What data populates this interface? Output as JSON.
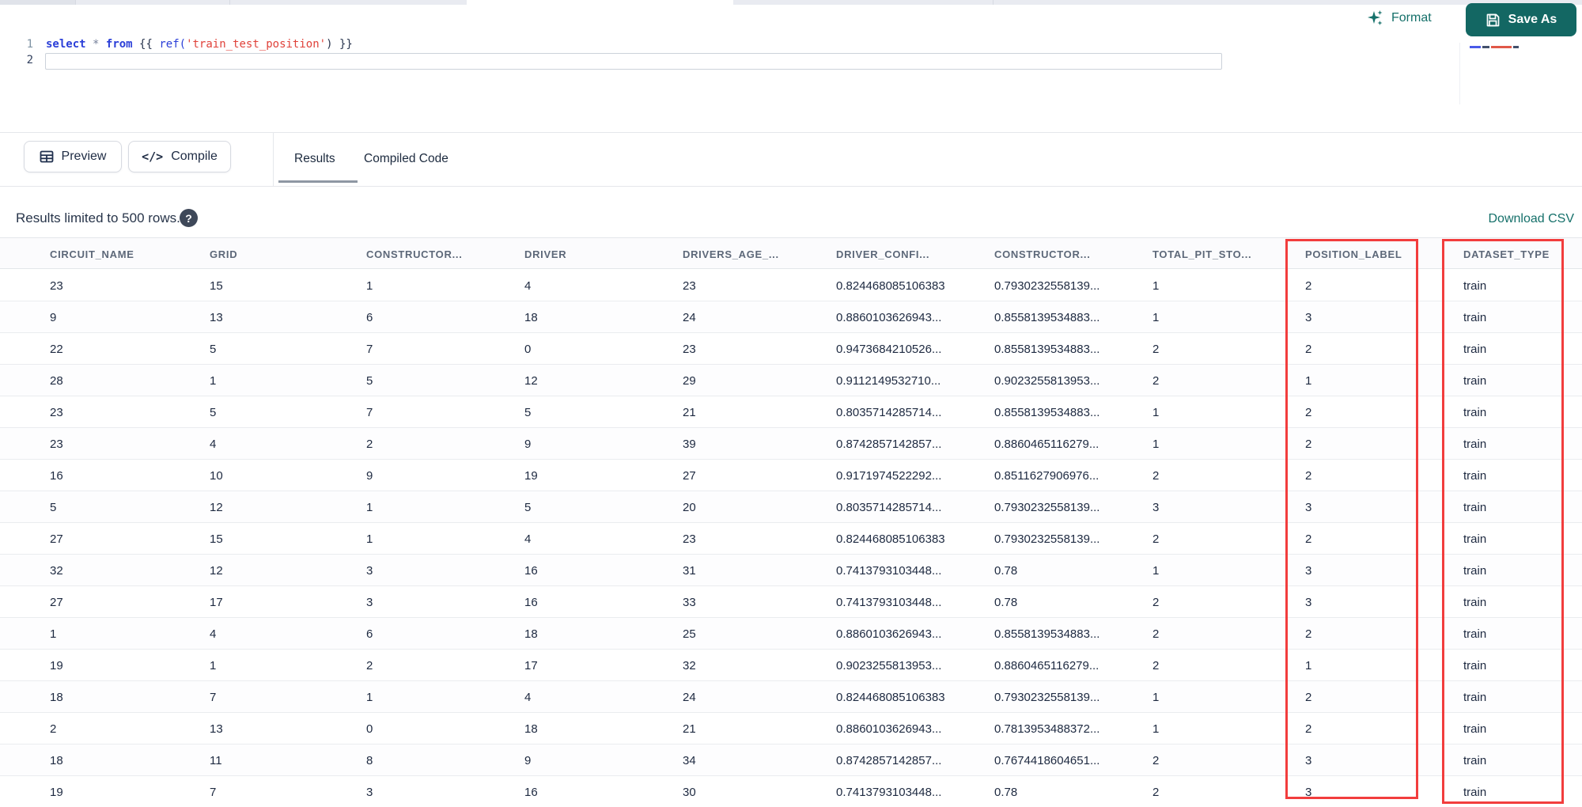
{
  "colors": {
    "accent_teal": "#136763",
    "highlight_red": "#f23d3d",
    "keyword_blue": "#2a3ed8",
    "string_red": "#e0423a"
  },
  "icons": {
    "format": "sparkles-icon",
    "save_as": "save-icon",
    "preview": "table-icon",
    "compile": "code-icon",
    "help": "question-icon"
  },
  "toolbar": {
    "format_label": "Format",
    "save_as_label": "Save As"
  },
  "editor": {
    "line1_number": "1",
    "line2_number": "2",
    "code_tokens": [
      {
        "text": "select",
        "type": "keyword"
      },
      {
        "text": " ",
        "type": "plain"
      },
      {
        "text": "*",
        "type": "operator"
      },
      {
        "text": " ",
        "type": "plain"
      },
      {
        "text": "from",
        "type": "keyword"
      },
      {
        "text": " ",
        "type": "plain"
      },
      {
        "text": "{{",
        "type": "brace"
      },
      {
        "text": " ",
        "type": "plain"
      },
      {
        "text": "ref(",
        "type": "function"
      },
      {
        "text": "'train_test_position'",
        "type": "string"
      },
      {
        "text": ")",
        "type": "brace"
      },
      {
        "text": " ",
        "type": "plain"
      },
      {
        "text": "}}",
        "type": "brace"
      }
    ]
  },
  "actions": {
    "preview_label": "Preview",
    "compile_label": "Compile"
  },
  "tabs": {
    "results_label": "Results",
    "compiled_code_label": "Compiled Code",
    "active": "Results"
  },
  "results_bar": {
    "limit_text": "Results limited to 500 rows.",
    "download_csv_label": "Download CSV"
  },
  "table": {
    "columns": [
      "CIRCUIT_NAME",
      "GRID",
      "CONSTRUCTOR...",
      "DRIVER",
      "DRIVERS_AGE_...",
      "DRIVER_CONFI...",
      "CONSTRUCTOR...",
      "TOTAL_PIT_STO...",
      "POSITION_LABEL",
      "DATASET_TYPE"
    ],
    "highlighted_columns": [
      "POSITION_LABEL",
      "DATASET_TYPE"
    ],
    "rows": [
      [
        "23",
        "15",
        "1",
        "4",
        "23",
        "0.824468085106383",
        "0.7930232558139...",
        "1",
        "2",
        "train"
      ],
      [
        "9",
        "13",
        "6",
        "18",
        "24",
        "0.8860103626943...",
        "0.8558139534883...",
        "1",
        "3",
        "train"
      ],
      [
        "22",
        "5",
        "7",
        "0",
        "23",
        "0.9473684210526...",
        "0.8558139534883...",
        "2",
        "2",
        "train"
      ],
      [
        "28",
        "1",
        "5",
        "12",
        "29",
        "0.9112149532710...",
        "0.9023255813953...",
        "2",
        "1",
        "train"
      ],
      [
        "23",
        "5",
        "7",
        "5",
        "21",
        "0.8035714285714...",
        "0.8558139534883...",
        "1",
        "2",
        "train"
      ],
      [
        "23",
        "4",
        "2",
        "9",
        "39",
        "0.8742857142857...",
        "0.8860465116279...",
        "1",
        "2",
        "train"
      ],
      [
        "16",
        "10",
        "9",
        "19",
        "27",
        "0.9171974522292...",
        "0.8511627906976...",
        "2",
        "2",
        "train"
      ],
      [
        "5",
        "12",
        "1",
        "5",
        "20",
        "0.8035714285714...",
        "0.7930232558139...",
        "3",
        "3",
        "train"
      ],
      [
        "27",
        "15",
        "1",
        "4",
        "23",
        "0.824468085106383",
        "0.7930232558139...",
        "2",
        "2",
        "train"
      ],
      [
        "32",
        "12",
        "3",
        "16",
        "31",
        "0.7413793103448...",
        "0.78",
        "1",
        "3",
        "train"
      ],
      [
        "27",
        "17",
        "3",
        "16",
        "33",
        "0.7413793103448...",
        "0.78",
        "2",
        "3",
        "train"
      ],
      [
        "1",
        "4",
        "6",
        "18",
        "25",
        "0.8860103626943...",
        "0.8558139534883...",
        "2",
        "2",
        "train"
      ],
      [
        "19",
        "1",
        "2",
        "17",
        "32",
        "0.9023255813953...",
        "0.8860465116279...",
        "2",
        "1",
        "train"
      ],
      [
        "18",
        "7",
        "1",
        "4",
        "24",
        "0.824468085106383",
        "0.7930232558139...",
        "1",
        "2",
        "train"
      ],
      [
        "2",
        "13",
        "0",
        "18",
        "21",
        "0.8860103626943...",
        "0.7813953488372...",
        "1",
        "2",
        "train"
      ],
      [
        "18",
        "11",
        "8",
        "9",
        "34",
        "0.8742857142857...",
        "0.7674418604651...",
        "2",
        "3",
        "train"
      ],
      [
        "19",
        "7",
        "3",
        "16",
        "30",
        "0.7413793103448...",
        "0.78",
        "2",
        "3",
        "train"
      ]
    ]
  }
}
